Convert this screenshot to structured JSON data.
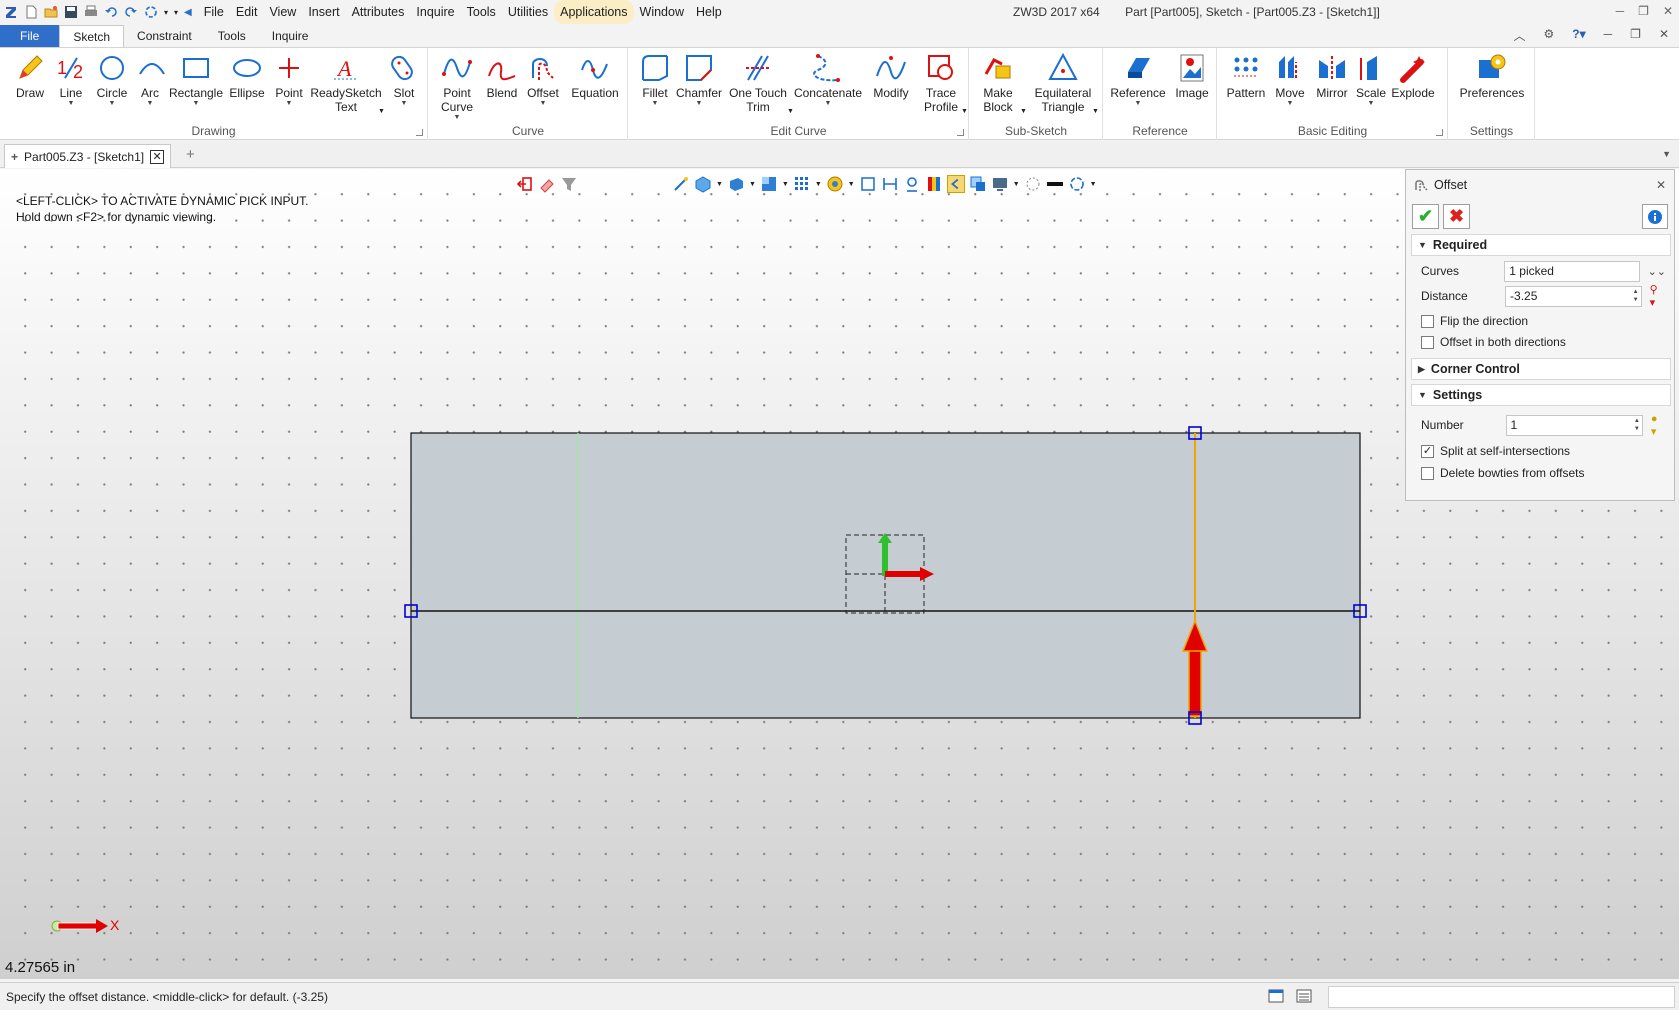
{
  "titlebar": {
    "menu": [
      "File",
      "Edit",
      "View",
      "Insert",
      "Attributes",
      "Inquire",
      "Tools",
      "Utilities",
      "Applications",
      "Window",
      "Help"
    ],
    "app": "ZW3D 2017  x64",
    "document": "Part [Part005],  Sketch - [Part005.Z3 - [Sketch1]]"
  },
  "ribbon_tabs": {
    "file": "File",
    "tabs": [
      "Sketch",
      "Constraint",
      "Tools",
      "Inquire"
    ]
  },
  "ribbon": {
    "drawing": {
      "label": "Drawing",
      "tools": [
        "Draw",
        "Line",
        "Circle",
        "Arc",
        "Rectangle",
        "Ellipse",
        "Point",
        "ReadySketch Text",
        "Slot"
      ]
    },
    "curve": {
      "label": "Curve",
      "tools": [
        "Point Curve",
        "Blend",
        "Offset",
        "Equation"
      ]
    },
    "edit_curve": {
      "label": "Edit Curve",
      "tools": [
        "Fillet",
        "Chamfer",
        "One Touch Trim",
        "Concatenate",
        "Modify",
        "Trace Profile"
      ]
    },
    "sub_sketch": {
      "label": "Sub-Sketch",
      "tools": [
        "Make Block",
        "Equilateral Triangle"
      ]
    },
    "reference": {
      "label": "Reference",
      "tools": [
        "Reference",
        "Image"
      ]
    },
    "basic_editing": {
      "label": "Basic Editing",
      "tools": [
        "Pattern",
        "Move",
        "Mirror",
        "Scale",
        "Explode"
      ]
    },
    "settings": {
      "label": "Settings",
      "tools": [
        "Preferences"
      ]
    }
  },
  "doc_tab": {
    "label": "Part005.Z3 - [Sketch1]"
  },
  "viewport": {
    "hint_line1": "<LEFT-CLICK> TO ACTIVATE DYNAMIC PICK INPUT.",
    "hint_line2": "Hold down <F2> for dynamic viewing.",
    "axis_label": "X",
    "coordinate": "4.27565 in"
  },
  "offset_panel": {
    "title": "Offset",
    "required": {
      "label": "Required",
      "curves_label": "Curves",
      "curves_value": "1 picked",
      "distance_label": "Distance",
      "distance_value": "-3.25",
      "flip_label": "Flip the direction",
      "flip_checked": false,
      "both_label": "Offset in both directions",
      "both_checked": false
    },
    "corner_control": {
      "label": "Corner Control"
    },
    "settings": {
      "label": "Settings",
      "number_label": "Number",
      "number_value": "1",
      "split_label": "Split at self-intersections",
      "split_checked": true,
      "bowties_label": "Delete bowties from offsets",
      "bowties_checked": false
    }
  },
  "statusbar": {
    "message": "Specify the offset distance.   <middle-click> for default. (-3.25)"
  },
  "colors": {
    "file_tab": "#2f6fc9",
    "sketch_fill": "#c5cdd2",
    "handle": "#0000dd",
    "selected_curve": "#f0a500",
    "arrow_red": "#e00000",
    "preview_line": "#9fe89f"
  }
}
